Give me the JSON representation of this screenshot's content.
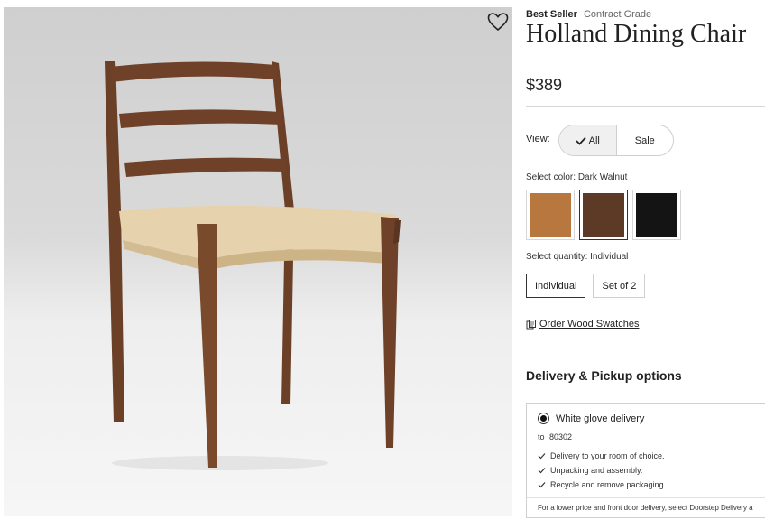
{
  "product": {
    "badge": "Best Seller",
    "grade": "Contract Grade",
    "title": "Holland Dining Chair",
    "price": "$389",
    "image_icon": "chair-image"
  },
  "favorite": {
    "icon": "heart-outline-icon"
  },
  "view": {
    "label": "View:",
    "options": [
      {
        "label": "All",
        "selected": true,
        "icon": "check-icon"
      },
      {
        "label": "Sale",
        "selected": false
      }
    ]
  },
  "color": {
    "label": "Select color:",
    "value": "Dark Walnut",
    "swatches": [
      {
        "color": "#b8773e",
        "selected": false
      },
      {
        "color": "#5c3a26",
        "selected": true
      },
      {
        "color": "#141414",
        "selected": false
      }
    ]
  },
  "quantity": {
    "label": "Select quantity:",
    "value": "Individual",
    "options": [
      {
        "label": "Individual",
        "selected": true
      },
      {
        "label": "Set of 2",
        "selected": false
      }
    ]
  },
  "swatch_link": {
    "label": "Order Wood Swatches",
    "icon": "wood-swatch-icon"
  },
  "delivery": {
    "heading": "Delivery & Pickup options",
    "option_label": "White glove delivery",
    "to_label": "to",
    "zip": "80302",
    "bullets": [
      "Delivery to your room of choice.",
      "Unpacking and assembly.",
      "Recycle and remove packaging."
    ],
    "footnote": "For a lower price and front door delivery, select Doorstep Delivery a"
  }
}
